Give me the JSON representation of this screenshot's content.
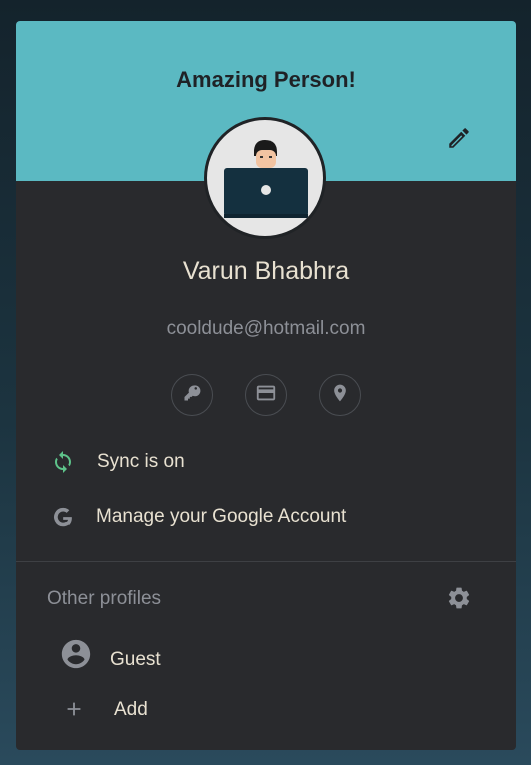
{
  "header": {
    "title": "Amazing Person!",
    "edit_icon": "pencil-icon",
    "background_color": "#5bb9c2"
  },
  "profile": {
    "name": "Varun Bhabhra",
    "email": "cooldude@hotmail.com",
    "avatar_icon": "person-with-laptop-avatar"
  },
  "quick_actions": [
    {
      "icon": "key-icon",
      "name": "passwords"
    },
    {
      "icon": "credit-card-icon",
      "name": "payment-methods"
    },
    {
      "icon": "location-pin-icon",
      "name": "addresses"
    }
  ],
  "sync": {
    "label": "Sync is on",
    "icon": "sync-icon",
    "color": "#5ec38a"
  },
  "account": {
    "label": "Manage your Google Account",
    "icon": "google-g-icon"
  },
  "other_profiles": {
    "title": "Other profiles",
    "settings_icon": "gear-icon",
    "items": [
      {
        "label": "Guest",
        "icon": "account-circle-icon"
      },
      {
        "label": "Add",
        "icon": "plus-icon"
      }
    ]
  }
}
